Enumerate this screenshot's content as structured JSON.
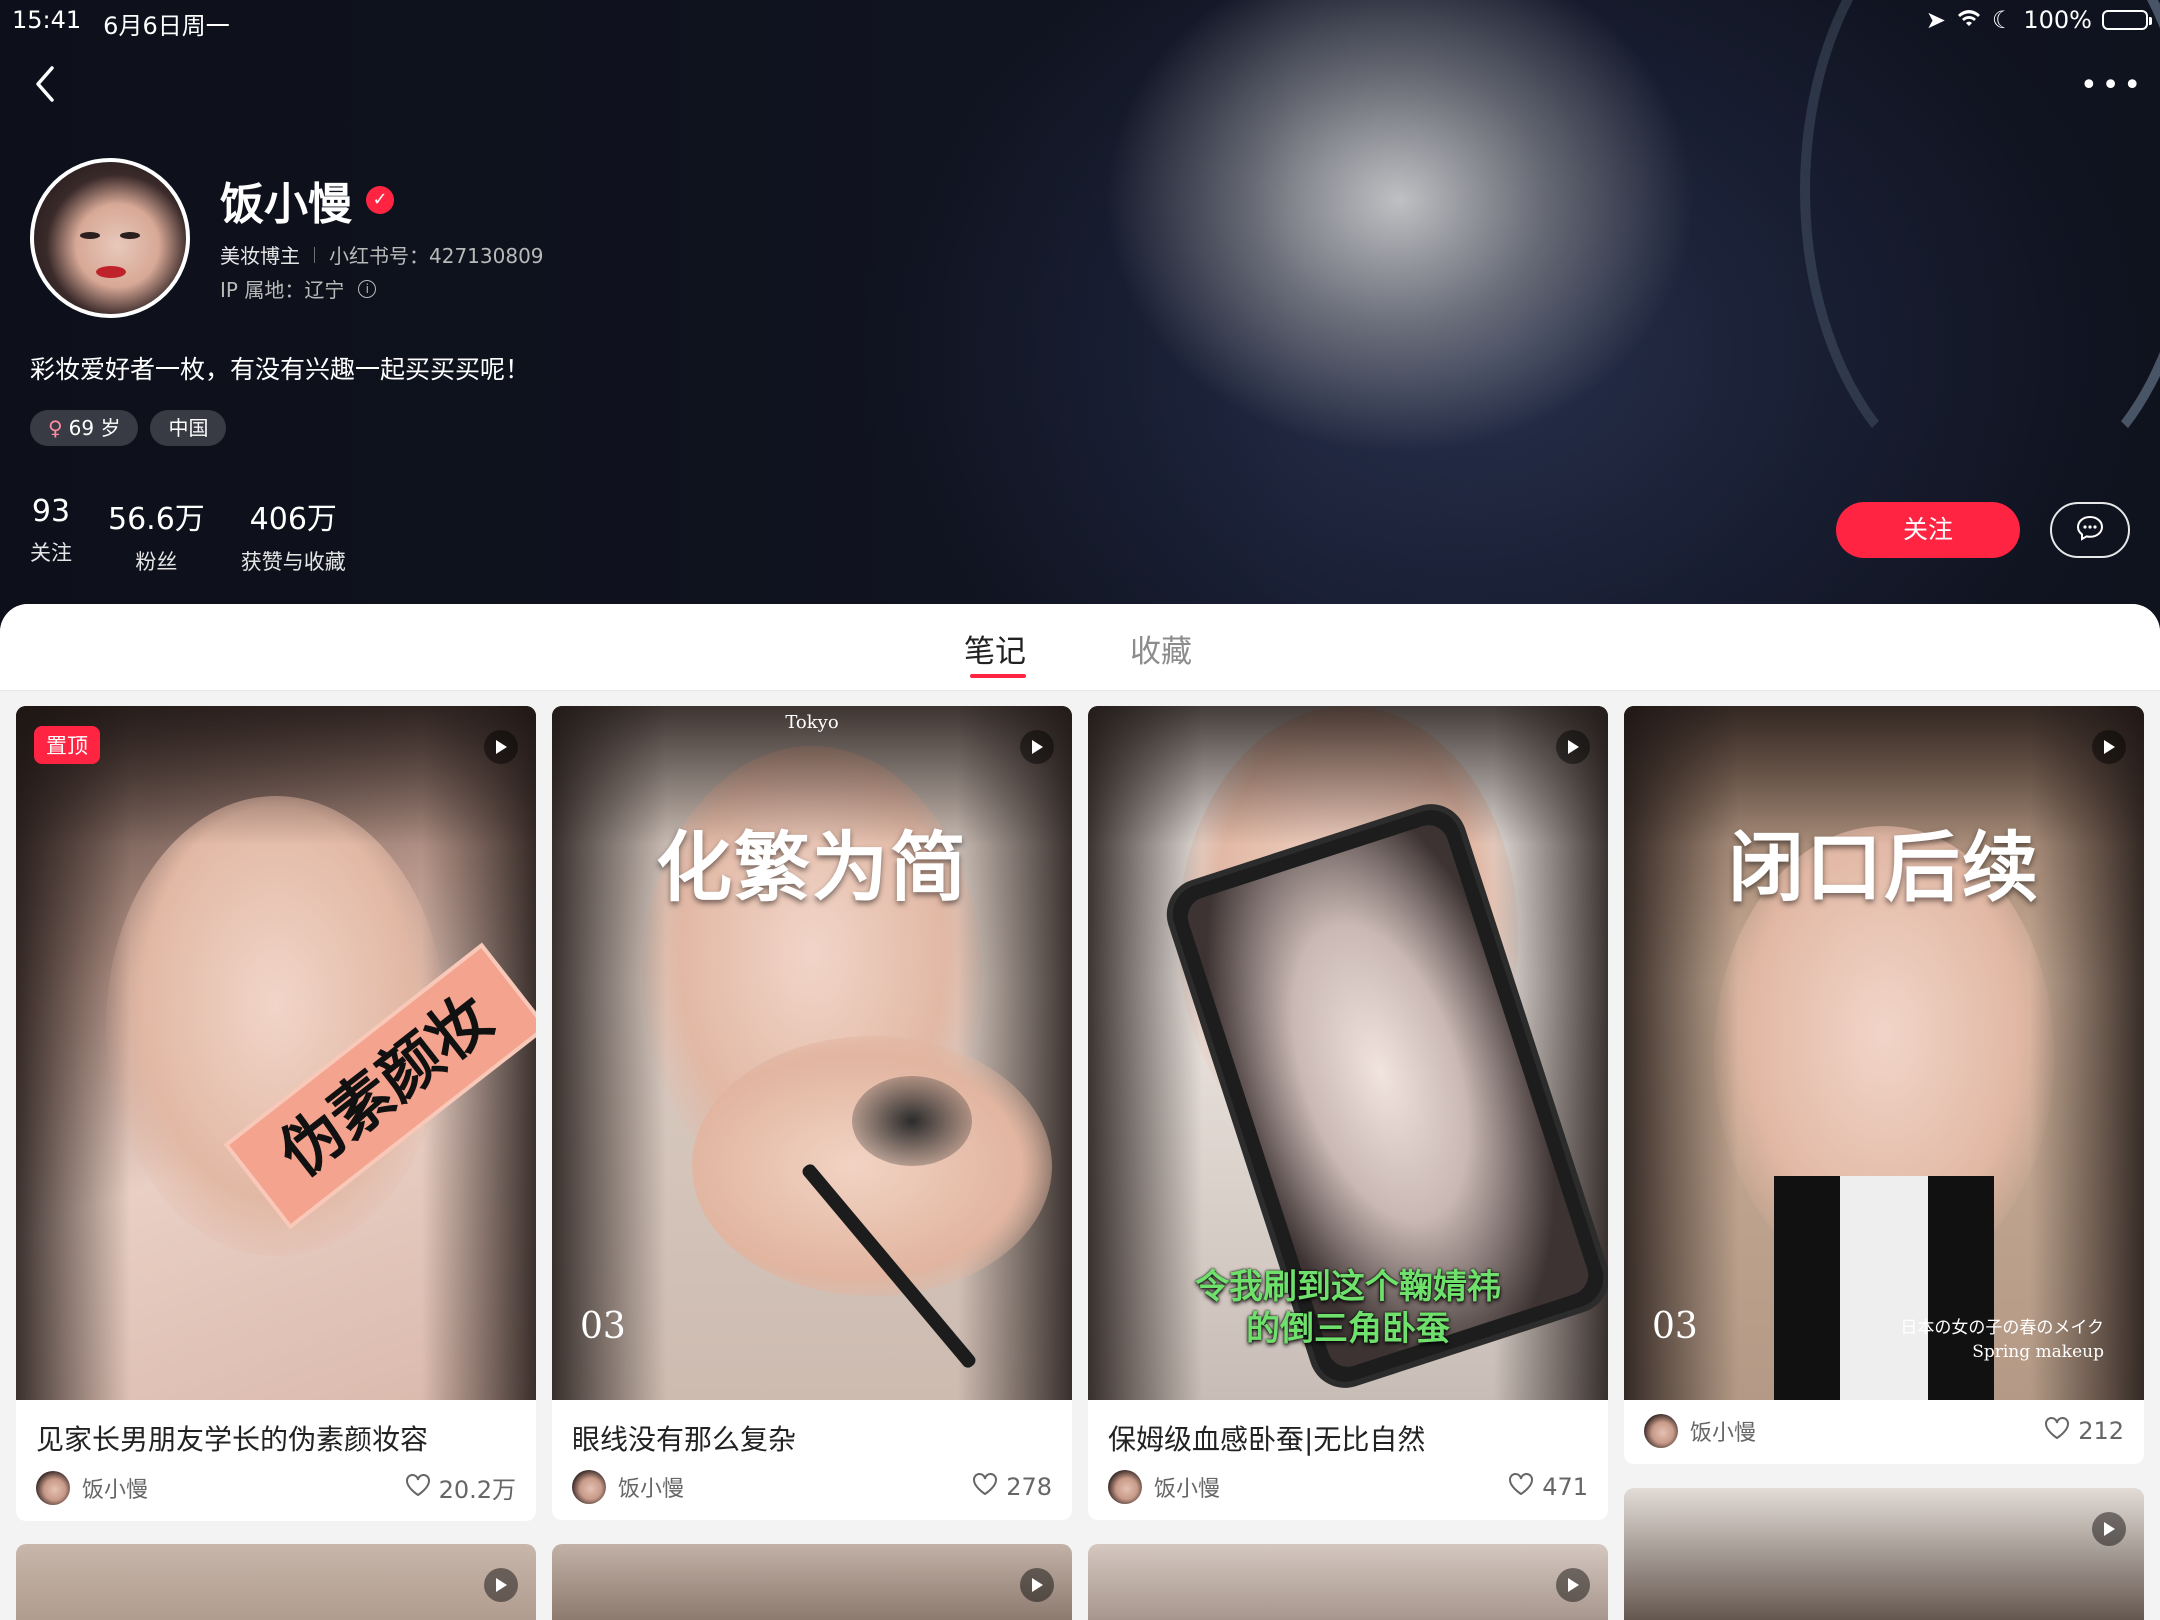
{
  "status_bar": {
    "time": "15:41",
    "date": "6月6日周一",
    "battery": "100%"
  },
  "profile": {
    "name": "饭小慢",
    "role": "美妆博主",
    "id_label": "小红书号：427130809",
    "ip_label": "IP 属地：辽宁",
    "bio": "彩妆爱好者一枚，有没有兴趣一起买买买呢！",
    "tags": {
      "age": "69 岁",
      "region": "中国"
    },
    "stats": {
      "following": {
        "num": "93",
        "label": "关注"
      },
      "fans": {
        "num": "56.6万",
        "label": "粉丝"
      },
      "likes": {
        "num": "406万",
        "label": "获赞与收藏"
      }
    },
    "follow_button": "关注"
  },
  "tabs": {
    "notes": "笔记",
    "collect": "收藏"
  },
  "notes": [
    {
      "title": "见家长男朋友学长的伪素颜妆容",
      "author": "饭小慢",
      "likes": "20.2万",
      "badge": "置顶",
      "overlay": "伪素颜妆"
    },
    {
      "title": "眼线没有那么复杂",
      "author": "饭小慢",
      "likes": "278",
      "overlay": "化繁为简",
      "corner_text": "Tokyo",
      "number": "03"
    },
    {
      "title": "保姆级血感卧蚕|无比自然",
      "author": "饭小慢",
      "likes": "471",
      "caption_line1": "令我刷到这个鞠婧祎",
      "caption_line2": "的倒三角卧蚕"
    },
    {
      "author": "饭小慢",
      "likes": "212",
      "overlay": "闭口后续",
      "number": "03",
      "jp_line1": "日本の女の子の春のメイク",
      "jp_line2": "Spring makeup"
    }
  ],
  "colors": {
    "accent": "#ff2442",
    "header_bg": "#111522"
  }
}
